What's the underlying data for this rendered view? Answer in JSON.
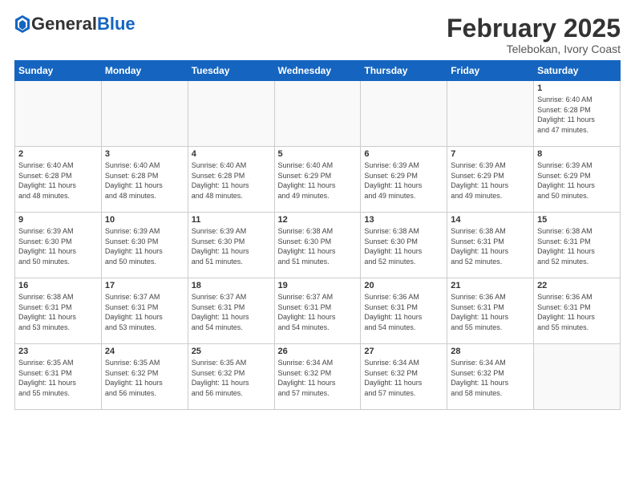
{
  "header": {
    "logo_general": "General",
    "logo_blue": "Blue",
    "month": "February 2025",
    "location": "Telebokan, Ivory Coast"
  },
  "weekdays": [
    "Sunday",
    "Monday",
    "Tuesday",
    "Wednesday",
    "Thursday",
    "Friday",
    "Saturday"
  ],
  "weeks": [
    [
      {
        "day": "",
        "info": ""
      },
      {
        "day": "",
        "info": ""
      },
      {
        "day": "",
        "info": ""
      },
      {
        "day": "",
        "info": ""
      },
      {
        "day": "",
        "info": ""
      },
      {
        "day": "",
        "info": ""
      },
      {
        "day": "1",
        "info": "Sunrise: 6:40 AM\nSunset: 6:28 PM\nDaylight: 11 hours\nand 47 minutes."
      }
    ],
    [
      {
        "day": "2",
        "info": "Sunrise: 6:40 AM\nSunset: 6:28 PM\nDaylight: 11 hours\nand 48 minutes."
      },
      {
        "day": "3",
        "info": "Sunrise: 6:40 AM\nSunset: 6:28 PM\nDaylight: 11 hours\nand 48 minutes."
      },
      {
        "day": "4",
        "info": "Sunrise: 6:40 AM\nSunset: 6:28 PM\nDaylight: 11 hours\nand 48 minutes."
      },
      {
        "day": "5",
        "info": "Sunrise: 6:40 AM\nSunset: 6:29 PM\nDaylight: 11 hours\nand 49 minutes."
      },
      {
        "day": "6",
        "info": "Sunrise: 6:39 AM\nSunset: 6:29 PM\nDaylight: 11 hours\nand 49 minutes."
      },
      {
        "day": "7",
        "info": "Sunrise: 6:39 AM\nSunset: 6:29 PM\nDaylight: 11 hours\nand 49 minutes."
      },
      {
        "day": "8",
        "info": "Sunrise: 6:39 AM\nSunset: 6:29 PM\nDaylight: 11 hours\nand 50 minutes."
      }
    ],
    [
      {
        "day": "9",
        "info": "Sunrise: 6:39 AM\nSunset: 6:30 PM\nDaylight: 11 hours\nand 50 minutes."
      },
      {
        "day": "10",
        "info": "Sunrise: 6:39 AM\nSunset: 6:30 PM\nDaylight: 11 hours\nand 50 minutes."
      },
      {
        "day": "11",
        "info": "Sunrise: 6:39 AM\nSunset: 6:30 PM\nDaylight: 11 hours\nand 51 minutes."
      },
      {
        "day": "12",
        "info": "Sunrise: 6:38 AM\nSunset: 6:30 PM\nDaylight: 11 hours\nand 51 minutes."
      },
      {
        "day": "13",
        "info": "Sunrise: 6:38 AM\nSunset: 6:30 PM\nDaylight: 11 hours\nand 52 minutes."
      },
      {
        "day": "14",
        "info": "Sunrise: 6:38 AM\nSunset: 6:31 PM\nDaylight: 11 hours\nand 52 minutes."
      },
      {
        "day": "15",
        "info": "Sunrise: 6:38 AM\nSunset: 6:31 PM\nDaylight: 11 hours\nand 52 minutes."
      }
    ],
    [
      {
        "day": "16",
        "info": "Sunrise: 6:38 AM\nSunset: 6:31 PM\nDaylight: 11 hours\nand 53 minutes."
      },
      {
        "day": "17",
        "info": "Sunrise: 6:37 AM\nSunset: 6:31 PM\nDaylight: 11 hours\nand 53 minutes."
      },
      {
        "day": "18",
        "info": "Sunrise: 6:37 AM\nSunset: 6:31 PM\nDaylight: 11 hours\nand 54 minutes."
      },
      {
        "day": "19",
        "info": "Sunrise: 6:37 AM\nSunset: 6:31 PM\nDaylight: 11 hours\nand 54 minutes."
      },
      {
        "day": "20",
        "info": "Sunrise: 6:36 AM\nSunset: 6:31 PM\nDaylight: 11 hours\nand 54 minutes."
      },
      {
        "day": "21",
        "info": "Sunrise: 6:36 AM\nSunset: 6:31 PM\nDaylight: 11 hours\nand 55 minutes."
      },
      {
        "day": "22",
        "info": "Sunrise: 6:36 AM\nSunset: 6:31 PM\nDaylight: 11 hours\nand 55 minutes."
      }
    ],
    [
      {
        "day": "23",
        "info": "Sunrise: 6:35 AM\nSunset: 6:31 PM\nDaylight: 11 hours\nand 55 minutes."
      },
      {
        "day": "24",
        "info": "Sunrise: 6:35 AM\nSunset: 6:32 PM\nDaylight: 11 hours\nand 56 minutes."
      },
      {
        "day": "25",
        "info": "Sunrise: 6:35 AM\nSunset: 6:32 PM\nDaylight: 11 hours\nand 56 minutes."
      },
      {
        "day": "26",
        "info": "Sunrise: 6:34 AM\nSunset: 6:32 PM\nDaylight: 11 hours\nand 57 minutes."
      },
      {
        "day": "27",
        "info": "Sunrise: 6:34 AM\nSunset: 6:32 PM\nDaylight: 11 hours\nand 57 minutes."
      },
      {
        "day": "28",
        "info": "Sunrise: 6:34 AM\nSunset: 6:32 PM\nDaylight: 11 hours\nand 58 minutes."
      },
      {
        "day": "",
        "info": ""
      }
    ]
  ]
}
